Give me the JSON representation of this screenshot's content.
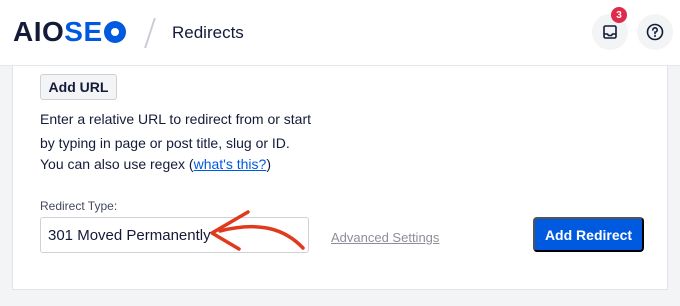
{
  "header": {
    "logo_part1": "AIO",
    "logo_part2": "SE",
    "page_title": "Redirects",
    "notification_count": "3"
  },
  "form": {
    "add_url_label": "Add URL",
    "help_line1": "Enter a relative URL to redirect from or start",
    "help_line2": "by typing in page or post title, slug or ID.",
    "help_line3_prefix": "You can also use regex (",
    "help_link": "what's this?",
    "help_line3_suffix": ")",
    "redirect_type_label": "Redirect Type:",
    "redirect_type_value": "301 Moved Permanently",
    "advanced_settings_label": "Advanced Settings",
    "add_redirect_label": "Add Redirect"
  },
  "colors": {
    "brand_blue": "#005ae0",
    "badge_red": "#df2a4a",
    "annotation_arrow": "#e03a1e"
  },
  "icons": {
    "inbox": "inbox-icon",
    "help": "help-circle-icon",
    "logo_gear": "gear-icon"
  }
}
